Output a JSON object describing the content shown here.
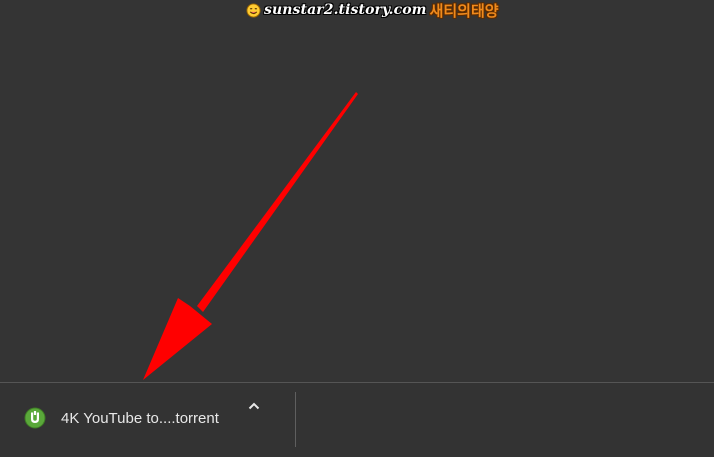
{
  "watermark": {
    "url": "sunstar2.tistory.com",
    "korean": "새티의태양"
  },
  "download_shelf": {
    "item_name": "4K YouTube to....torrent",
    "item_icon": "utorrent-icon",
    "expand_icon": "chevron-up-icon"
  },
  "colors": {
    "background": "#343434",
    "arrow": "#ff0000",
    "utorrent_green": "#5aa83a",
    "text": "#e8e8e8"
  }
}
